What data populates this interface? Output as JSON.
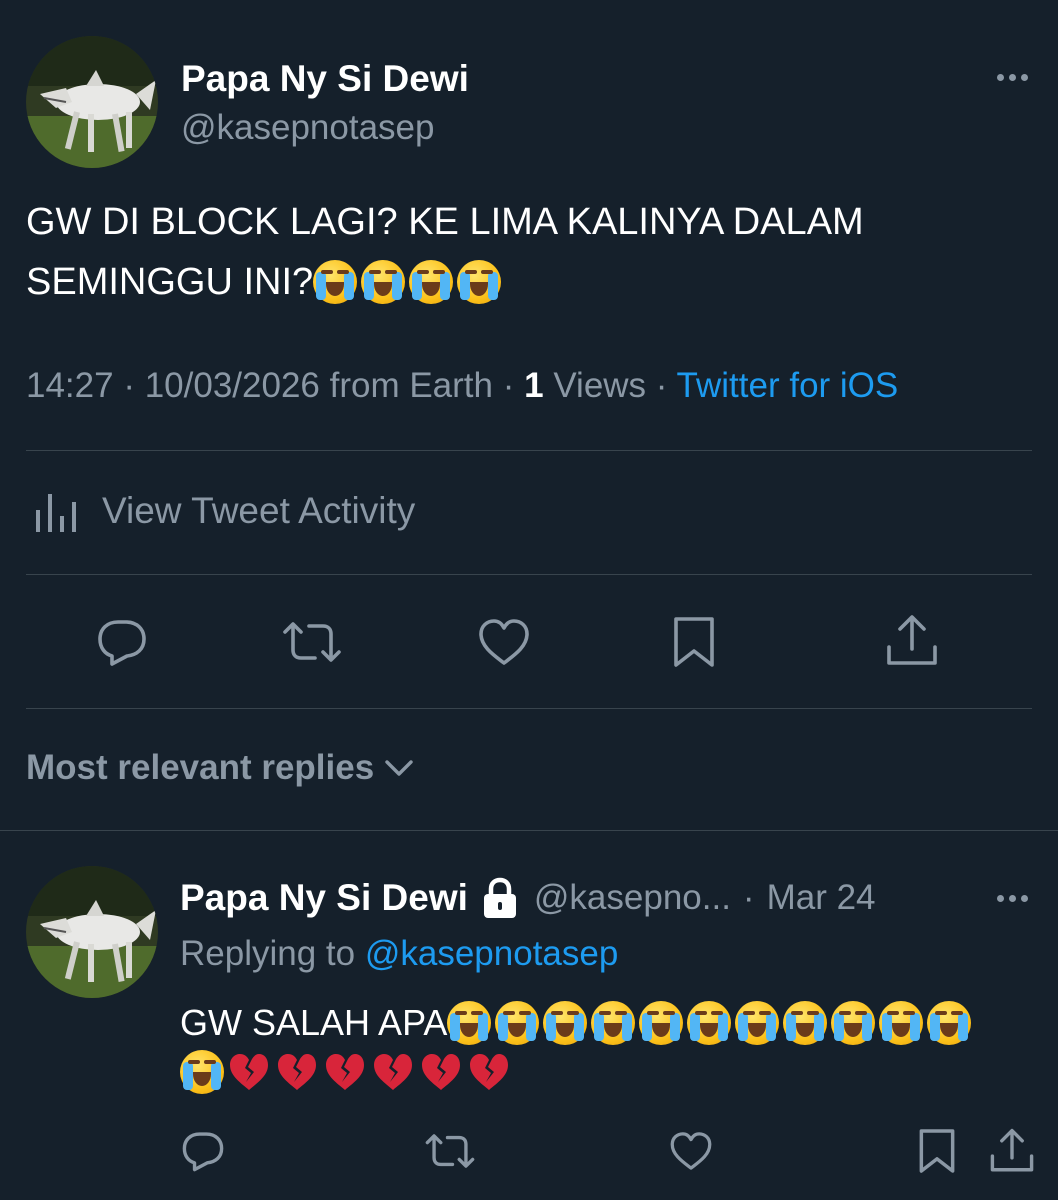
{
  "tweet": {
    "display_name": "Papa Ny Si Dewi",
    "handle": "@kasepnotasep",
    "text_line1": "GW DI BLOCK LAGI? KE LIMA KALINYA DALAM",
    "text_line2": "SEMINGGU INI?",
    "text_line2_emoji": [
      "loudly-crying-face",
      "loudly-crying-face",
      "loudly-crying-face",
      "loudly-crying-face"
    ],
    "time": "14:27",
    "separator": "·",
    "date": "10/03/2026 from Earth",
    "views_count": "1",
    "views_label": "Views",
    "source": "Twitter for iOS"
  },
  "activity": {
    "icon": "bar-chart-icon",
    "label": "View Tweet Activity"
  },
  "actions": [
    {
      "name": "reply",
      "icon": "reply-icon"
    },
    {
      "name": "retweet",
      "icon": "retweet-icon"
    },
    {
      "name": "like",
      "icon": "heart-icon"
    },
    {
      "name": "bookmark",
      "icon": "bookmark-icon"
    },
    {
      "name": "share",
      "icon": "share-icon"
    }
  ],
  "replies": {
    "sort_label": "Most relevant replies",
    "sort_icon": "chevron-down-icon"
  },
  "reply": {
    "display_name": "Papa Ny Si Dewi",
    "lock_icon": "lock-icon",
    "handle": "@kasepno...",
    "separator": "·",
    "date": "Mar 24",
    "replying_prefix": "Replying to",
    "replying_handle": "@kasepnotasep",
    "text": "GW SALAH APA",
    "emoji_line1": [
      "loudly-crying-face",
      "loudly-crying-face",
      "loudly-crying-face",
      "loudly-crying-face",
      "loudly-crying-face",
      "loudly-crying-face",
      "loudly-crying-face",
      "loudly-crying-face",
      "loudly-crying-face",
      "loudly-crying-face",
      "loudly-crying-face"
    ],
    "emoji_line2": [
      "loudly-crying-face",
      "broken-heart",
      "broken-heart",
      "broken-heart",
      "broken-heart",
      "broken-heart",
      "broken-heart"
    ]
  },
  "colors": {
    "background": "#15202b",
    "text": "#ffffff",
    "muted": "#8b98a5",
    "link": "#1d9bf0",
    "divider": "#38444d"
  }
}
